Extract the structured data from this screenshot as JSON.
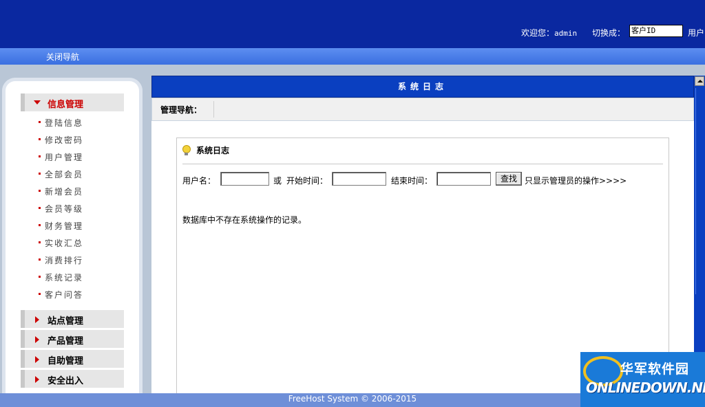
{
  "header": {
    "welcome_label": "欢迎您：",
    "username": "admin",
    "switch_label": "切换成：",
    "switch_value": "客户ID",
    "switch_user_label": "用户"
  },
  "navbar": {
    "close_nav": "关闭导航"
  },
  "sidebar": {
    "groups": [
      {
        "label": "信息管理",
        "expanded": true,
        "items": [
          "登陆信息",
          "修改密码",
          "用户管理",
          "全部会员",
          "新增会员",
          "会员等级",
          "财务管理",
          "实收汇总",
          "消费排行",
          "系统记录",
          "客户问答"
        ]
      },
      {
        "label": "站点管理",
        "expanded": false
      },
      {
        "label": "产品管理",
        "expanded": false
      },
      {
        "label": "自助管理",
        "expanded": false
      },
      {
        "label": "安全出入",
        "expanded": false
      }
    ]
  },
  "main": {
    "title": "系统日志",
    "manage_nav_label": "管理导航：",
    "panel": {
      "title": "系统日志",
      "username_label": "用户名：",
      "or_label": "或",
      "start_label": "开始时间：",
      "end_label": "结束时间：",
      "search_button": "查找",
      "admin_only_link": "只显示管理员的操作>>>>",
      "empty_message": "数据库中不存在系统操作的记录。"
    }
  },
  "footer": {
    "text": "FreeHost System © 2006-2015"
  },
  "watermark": {
    "cn": "华军软件园",
    "en": "ONLINEDOWN.NET"
  },
  "colors": {
    "header_bg": "#0a28a0",
    "title_bar_bg": "#0a3fc0",
    "active_red": "#cc0000",
    "footer_bg": "#6e8fd8"
  },
  "icons": {
    "expanded": "triangle-down-icon",
    "collapsed": "triangle-right-icon",
    "bullet": "bullet-icon",
    "bulb": "lightbulb-icon"
  }
}
